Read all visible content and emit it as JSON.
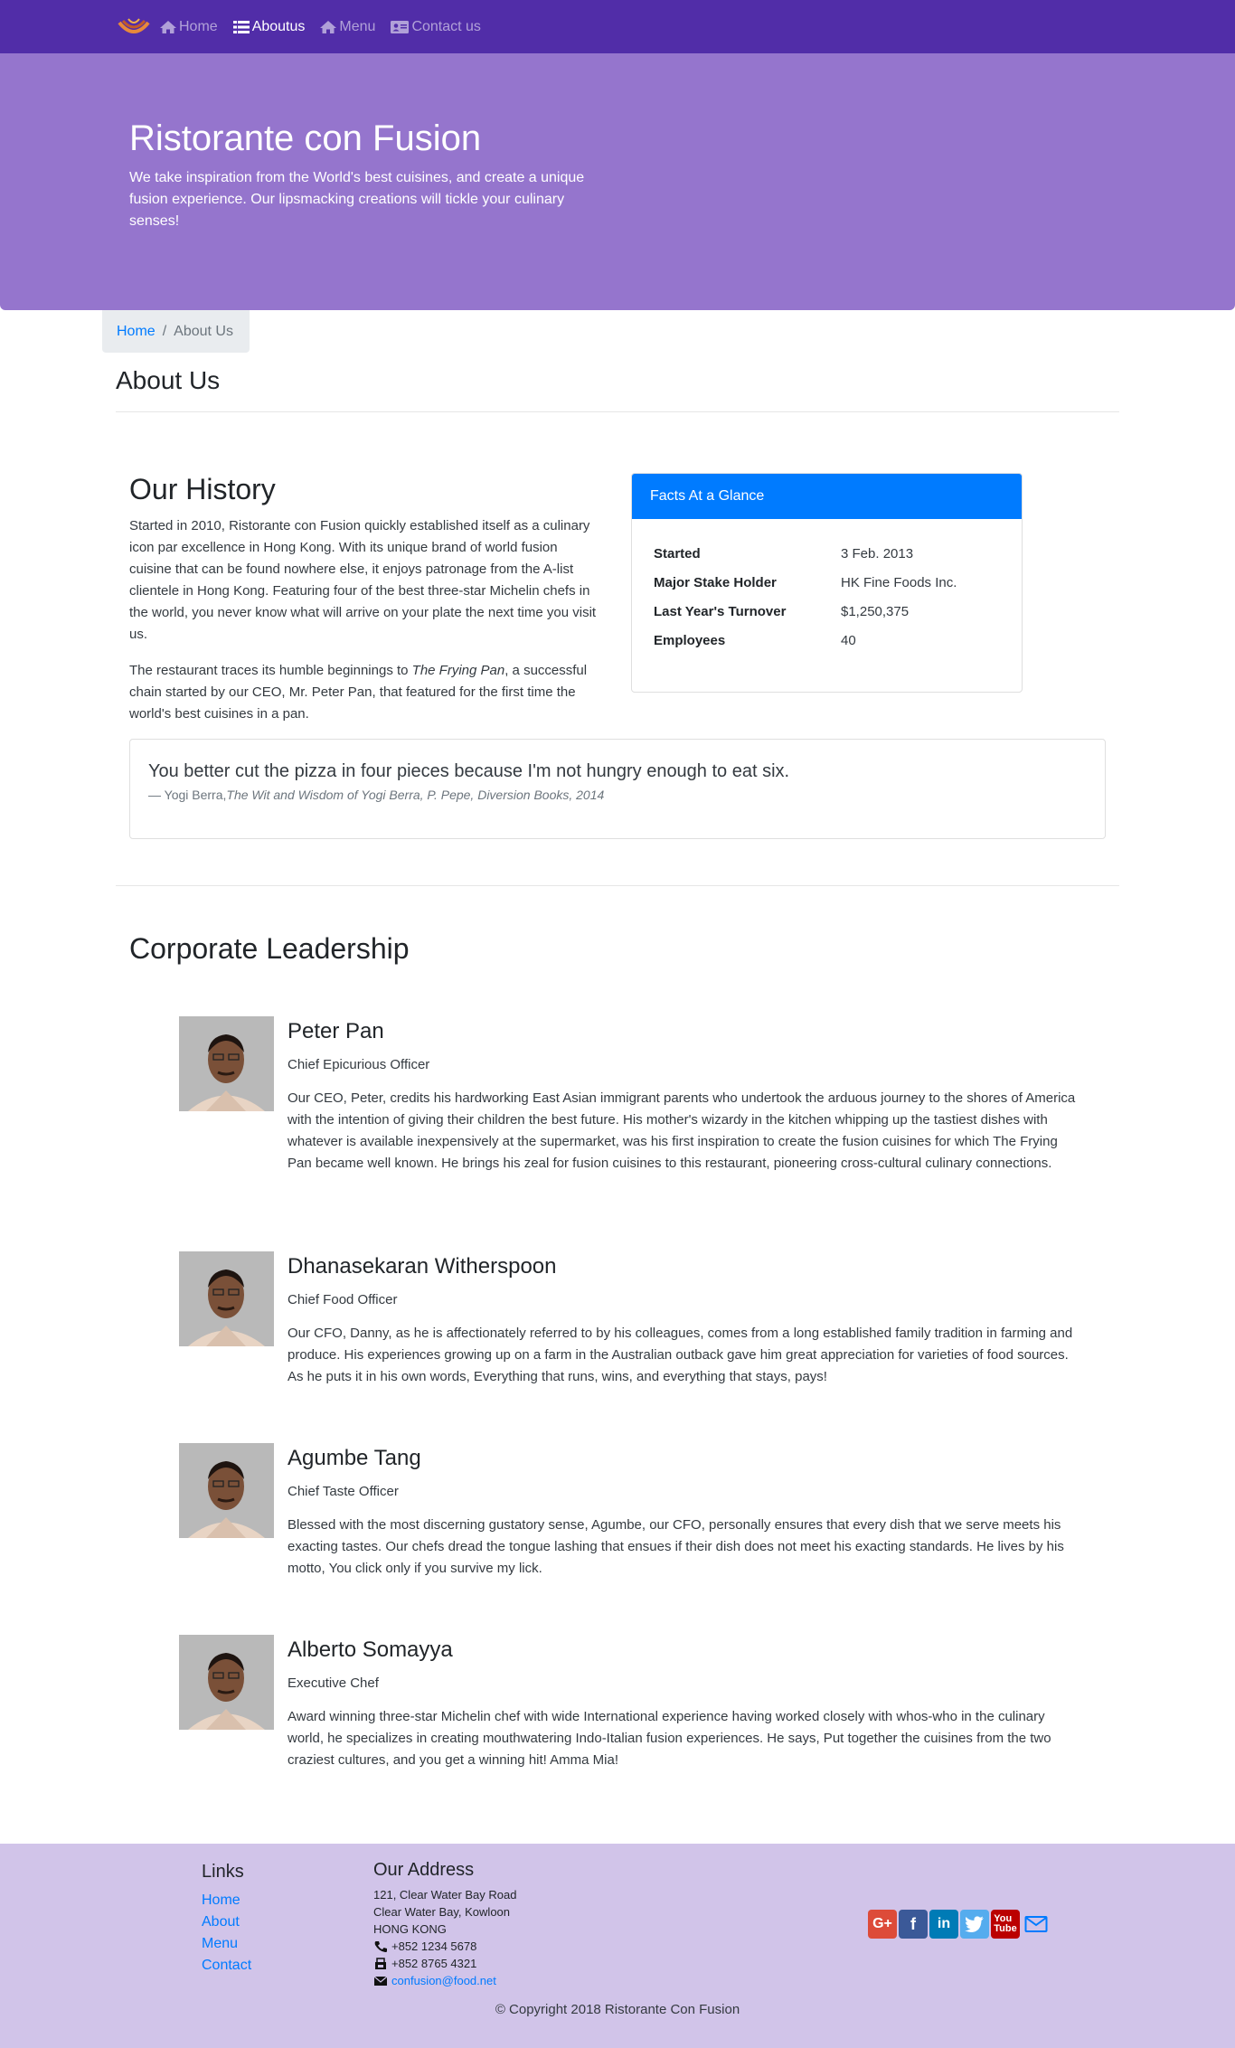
{
  "nav": {
    "items": [
      {
        "label": "Home",
        "icon": "home-icon"
      },
      {
        "label": "Aboutus",
        "icon": "list-icon"
      },
      {
        "label": "Menu",
        "icon": "home-icon"
      },
      {
        "label": "Contact us",
        "icon": "address-card-icon"
      }
    ]
  },
  "jumbotron": {
    "title": "Ristorante con Fusion",
    "text": "We take inspiration from the World's best cuisines, and create a unique fusion experience. Our lipsmacking creations will tickle your culinary senses!"
  },
  "breadcrumb": {
    "home": "Home",
    "current": "About Us"
  },
  "page_title": "About Us",
  "history": {
    "title": "Our History",
    "p1": "Started in 2010, Ristorante con Fusion quickly established itself as a culinary icon par excellence in Hong Kong. With its unique brand of world fusion cuisine that can be found nowhere else, it enjoys patronage from the A-list clientele in Hong Kong. Featuring four of the best three-star Michelin chefs in the world, you never know what will arrive on your plate the next time you visit us.",
    "p2_pre": "The restaurant traces its humble beginnings to ",
    "p2_em": "The Frying Pan",
    "p2_post": ", a successful chain started by our CEO, Mr. Peter Pan, that featured for the first time the world's best cuisines in a pan."
  },
  "facts": {
    "title": "Facts At a Glance",
    "rows": [
      {
        "key": "Started",
        "value": "3 Feb. 2013"
      },
      {
        "key": "Major Stake Holder",
        "value": "HK Fine Foods Inc."
      },
      {
        "key": "Last Year's Turnover",
        "value": "$1,250,375"
      },
      {
        "key": "Employees",
        "value": "40"
      }
    ]
  },
  "quote": {
    "text": "You better cut the pizza in four pieces because I'm not hungry enough to eat six.",
    "author": "— Yogi Berra,",
    "source": "The Wit and Wisdom of Yogi Berra, P. Pepe, Diversion Books, 2014"
  },
  "leadership": {
    "title": "Corporate Leadership",
    "leaders": [
      {
        "name": "Peter Pan",
        "role": "Chief Epicurious Officer",
        "desc": "Our CEO, Peter, credits his hardworking East Asian immigrant parents who undertook the arduous journey to the shores of America with the intention of giving their children the best future. His mother's wizardy in the kitchen whipping up the tastiest dishes with whatever is available inexpensively at the supermarket, was his first inspiration to create the fusion cuisines for which The Frying Pan became well known. He brings his zeal for fusion cuisines to this restaurant, pioneering cross-cultural culinary connections."
      },
      {
        "name": "Dhanasekaran Witherspoon",
        "role": "Chief Food Officer",
        "desc": "Our CFO, Danny, as he is affectionately referred to by his colleagues, comes from a long established family tradition in farming and produce. His experiences growing up on a farm in the Australian outback gave him great appreciation for varieties of food sources. As he puts it in his own words, Everything that runs, wins, and everything that stays, pays!"
      },
      {
        "name": "Agumbe Tang",
        "role": "Chief Taste Officer",
        "desc": "Blessed with the most discerning gustatory sense, Agumbe, our CFO, personally ensures that every dish that we serve meets his exacting tastes. Our chefs dread the tongue lashing that ensues if their dish does not meet his exacting standards. He lives by his motto, You click only if you survive my lick."
      },
      {
        "name": "Alberto Somayya",
        "role": "Executive Chef",
        "desc": "Award winning three-star Michelin chef with wide International experience having worked closely with whos-who in the culinary world, he specializes in creating mouthwatering Indo-Italian fusion experiences. He says, Put together the cuisines from the two craziest cultures, and you get a winning hit! Amma Mia!"
      }
    ]
  },
  "footer": {
    "links_title": "Links",
    "links": [
      "Home",
      "About",
      "Menu",
      "Contact"
    ],
    "address_title": "Our Address",
    "address_lines": [
      "121, Clear Water Bay Road",
      "Clear Water Bay, Kowloon",
      "HONG KONG"
    ],
    "phone": "+852 1234 5678",
    "fax": "+852 8765 4321",
    "email": "confusion@food.net",
    "social": [
      {
        "name": "google-plus-icon",
        "color": "#dd4b39"
      },
      {
        "name": "facebook-icon",
        "color": "#3b5998"
      },
      {
        "name": "linkedin-icon",
        "color": "#007bb6"
      },
      {
        "name": "twitter-icon",
        "color": "#55acee"
      },
      {
        "name": "youtube-icon",
        "color": "#bb0000"
      },
      {
        "name": "mail-icon",
        "color": "#007bff"
      }
    ],
    "copyright": "© Copyright 2018 Ristorante Con Fusion"
  },
  "colors": {
    "navbar": "#512da8",
    "jumbotron": "#9575cd",
    "footer": "#d1c4e9",
    "primary": "#007bff"
  }
}
